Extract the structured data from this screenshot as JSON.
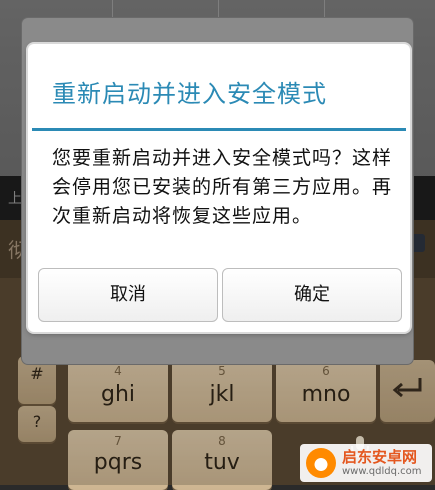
{
  "dialog": {
    "title": "重新启动并进入安全模式",
    "message": "您要重新启动并进入安全模式吗？这样会停用您已安装的所有第三方应用。再次重新启动将恢复这些应用。",
    "cancel_label": "取消",
    "ok_label": "确定"
  },
  "background": {
    "bar_peek_text": "上",
    "candidate_peek_text": "彻"
  },
  "keyboard": {
    "row1": [
      {
        "sub": "4",
        "main": "ghi"
      },
      {
        "sub": "5",
        "main": "jkl"
      },
      {
        "sub": "6",
        "main": "mno"
      }
    ],
    "row2": [
      {
        "sub": "7",
        "main": "pqrs"
      },
      {
        "sub": "8",
        "main": "tuv"
      }
    ],
    "side_keys": [
      "#",
      "?"
    ]
  },
  "watermark": {
    "name": "启东安卓网",
    "url": "www.qdldq.com"
  },
  "colors": {
    "accent": "#2b8ab5",
    "keyboard_bg": "#5b4a34",
    "key_face": "#dcc8a8"
  }
}
